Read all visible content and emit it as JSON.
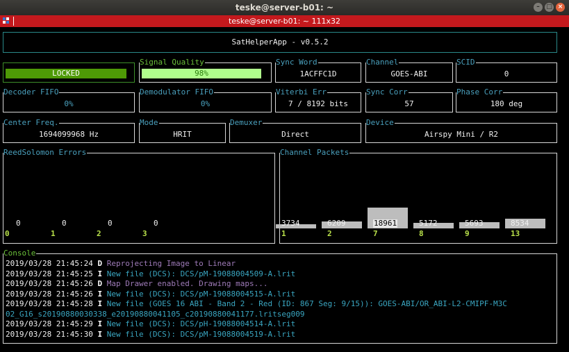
{
  "window": {
    "title": "teske@server-b01: ~",
    "tab_title": "teske@server-b01: ~ 111x32",
    "buttons": [
      "–",
      "□",
      "×"
    ]
  },
  "app_title": "SatHelperApp - v0.5.2",
  "status": {
    "lock_state": "LOCKED",
    "signal_quality_label": "Signal Quality",
    "signal_quality_value": "98%",
    "signal_quality_fraction": 0.98
  },
  "fields": {
    "sync_word": {
      "label": "Sync Word",
      "value": "1ACFFC1D"
    },
    "channel": {
      "label": "Channel",
      "value": "GOES-ABI"
    },
    "scid": {
      "label": "SCID",
      "value": "0"
    },
    "decoder_fifo": {
      "label": "Decoder FIFO",
      "value": "0%"
    },
    "demodulator_fifo": {
      "label": "Demodulator FIFO",
      "value": "0%"
    },
    "viterbi_err": {
      "label": "Viterbi Err",
      "value": "7 / 8192 bits"
    },
    "sync_corr": {
      "label": "Sync Corr",
      "value": "57"
    },
    "phase_corr": {
      "label": "Phase Corr",
      "value": "180 deg"
    },
    "center_freq": {
      "label": "Center Freq.",
      "value": "1694099968 Hz"
    },
    "mode": {
      "label": "Mode",
      "value": "HRIT"
    },
    "demuxer": {
      "label": "Demuxer",
      "value": "Direct"
    },
    "device": {
      "label": "Device",
      "value": "Airspy Mini / R2"
    }
  },
  "colors": {
    "accent_green": "#4e9a06",
    "quality_green": "#b0ff8c",
    "terminal_bg": "#000000",
    "tab_red": "#c4191d",
    "label_blue": "#4aa0bd",
    "debug_purple": "#9e7ab8",
    "info_cyan": "#3aa6c1"
  },
  "chart_data": [
    {
      "type": "bar",
      "title": "ReedSolomon Errors",
      "categories": [
        "0",
        "1",
        "2",
        "3"
      ],
      "values": [
        0,
        0,
        0,
        0
      ]
    },
    {
      "type": "bar",
      "title": "Channel Packets",
      "categories": [
        "1",
        "2",
        "7",
        "8",
        "9",
        "13"
      ],
      "values": [
        3734,
        6209,
        18961,
        5172,
        5693,
        8534
      ],
      "ylim": [
        0,
        18961
      ]
    }
  ],
  "console": {
    "label": "Console",
    "lines": [
      {
        "ts": "2019/03/28 21:45:24",
        "level": "D",
        "msg": "Reprojecting Image to Linear"
      },
      {
        "ts": "2019/03/28 21:45:25",
        "level": "I",
        "msg": "New file (DCS): DCS/pM-19088004509-A.lrit"
      },
      {
        "ts": "2019/03/28 21:45:26",
        "level": "D",
        "msg": "Map Drawer enabled. Drawing maps..."
      },
      {
        "ts": "2019/03/28 21:45:26",
        "level": "I",
        "msg": "New file (DCS): DCS/pM-19088004515-A.lrit"
      },
      {
        "ts": "2019/03/28 21:45:28",
        "level": "I",
        "msg": "New file (GOES 16 ABI - Band 2 - Red (ID: 867 Seg: 9/15)): GOES-ABI/OR_ABI-L2-CMIPF-M3C"
      },
      {
        "ts": "",
        "level": "",
        "msg": "02_G16_s20190880030338_e20190880041105_c20190880041177.lritseg009"
      },
      {
        "ts": "2019/03/28 21:45:29",
        "level": "I",
        "msg": "New file (DCS): DCS/pH-19088004514-A.lrit"
      },
      {
        "ts": "2019/03/28 21:45:30",
        "level": "I",
        "msg": "New file (DCS): DCS/pM-19088004519-A.lrit"
      }
    ]
  }
}
